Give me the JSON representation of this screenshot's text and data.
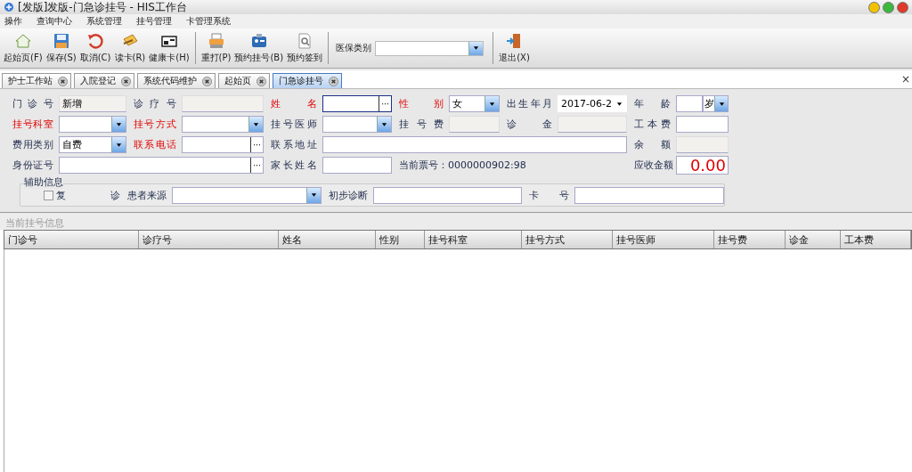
{
  "window": {
    "title": "[发版]发版-门急诊挂号 - HIS工作台"
  },
  "menu": [
    "操作",
    "查询中心",
    "系统管理",
    "挂号管理",
    "卡管理系统"
  ],
  "toolbar": {
    "groups": [
      [
        "起始页(F)",
        "保存(S)",
        "取消(C)",
        "读卡(R)",
        "健康卡(H)"
      ],
      [
        "重打(P)",
        "预约挂号(B)",
        "预约签到"
      ]
    ],
    "insurance": {
      "label": "医保类别"
    },
    "exit": "退出(X)"
  },
  "tabs": [
    {
      "label": "护士工作站",
      "selected": false
    },
    {
      "label": "入院登记",
      "selected": false
    },
    {
      "label": "系统代码维护",
      "selected": false
    },
    {
      "label": "起始页",
      "selected": false
    },
    {
      "label": "门急诊挂号",
      "selected": true
    }
  ],
  "tab_strip_close": "×",
  "form": {
    "rows": [
      [
        {
          "label": "门 诊 号",
          "kind": "disabled",
          "value": "新增",
          "required": false
        },
        {
          "label": "诊 疗 号",
          "kind": "disabled",
          "required": false
        },
        {
          "label": "姓 名",
          "kind": "ellipsis",
          "required": true,
          "focused": true,
          "button": "···"
        },
        {
          "label": "性 别",
          "kind": "dropdown",
          "value": "女",
          "required": true
        },
        {
          "label": "出生年月",
          "kind": "date",
          "value": "2017-06-2",
          "required": false
        },
        {
          "label": "年 龄",
          "kind": "age",
          "unit": "岁",
          "required": false
        }
      ],
      [
        {
          "label": "挂号科室",
          "kind": "dropdown",
          "required": true
        },
        {
          "label": "挂号方式",
          "kind": "dropdown",
          "required": true
        },
        {
          "label": "挂号医师",
          "kind": "dropdown",
          "required": false
        },
        {
          "label": "挂号费",
          "kind": "disabled",
          "required": false
        },
        {
          "label": "诊 金",
          "kind": "disabled",
          "required": false
        },
        {
          "label": "工本费",
          "kind": "text",
          "required": false
        }
      ],
      [
        {
          "label": "费用类别",
          "kind": "dropdown",
          "value": "自费",
          "required": false
        },
        {
          "label": "联系电话",
          "kind": "ellipsis",
          "required": true,
          "button": "···"
        },
        {
          "label": "联系地址",
          "kind": "text",
          "required": false
        },
        "",
        "",
        {
          "label": "余 额",
          "kind": "disabled",
          "required": false
        }
      ],
      [
        {
          "label": "身份证号",
          "kind": "ellipsis",
          "required": false,
          "button": "···"
        },
        "",
        {
          "label": "家长姓名",
          "kind": "text",
          "required": false
        },
        {
          "kind": "info",
          "text": "当前票号：0000000902:98"
        },
        "",
        {
          "label": "应收金额",
          "kind": "amount",
          "value": "0.00",
          "required": false
        }
      ]
    ],
    "aux": {
      "title": "辅助信息",
      "revisit": {
        "label": "复 诊",
        "checked": false
      },
      "source_label": "患者来源",
      "diagnosis_label": "初步诊断",
      "card_label": "卡 号"
    }
  },
  "table": {
    "title": "当前挂号信息",
    "columns": [
      "门诊号",
      "诊疗号",
      "姓名",
      "性别",
      "挂号科室",
      "挂号方式",
      "挂号医师",
      "挂号费",
      "诊金",
      "工本费"
    ]
  }
}
